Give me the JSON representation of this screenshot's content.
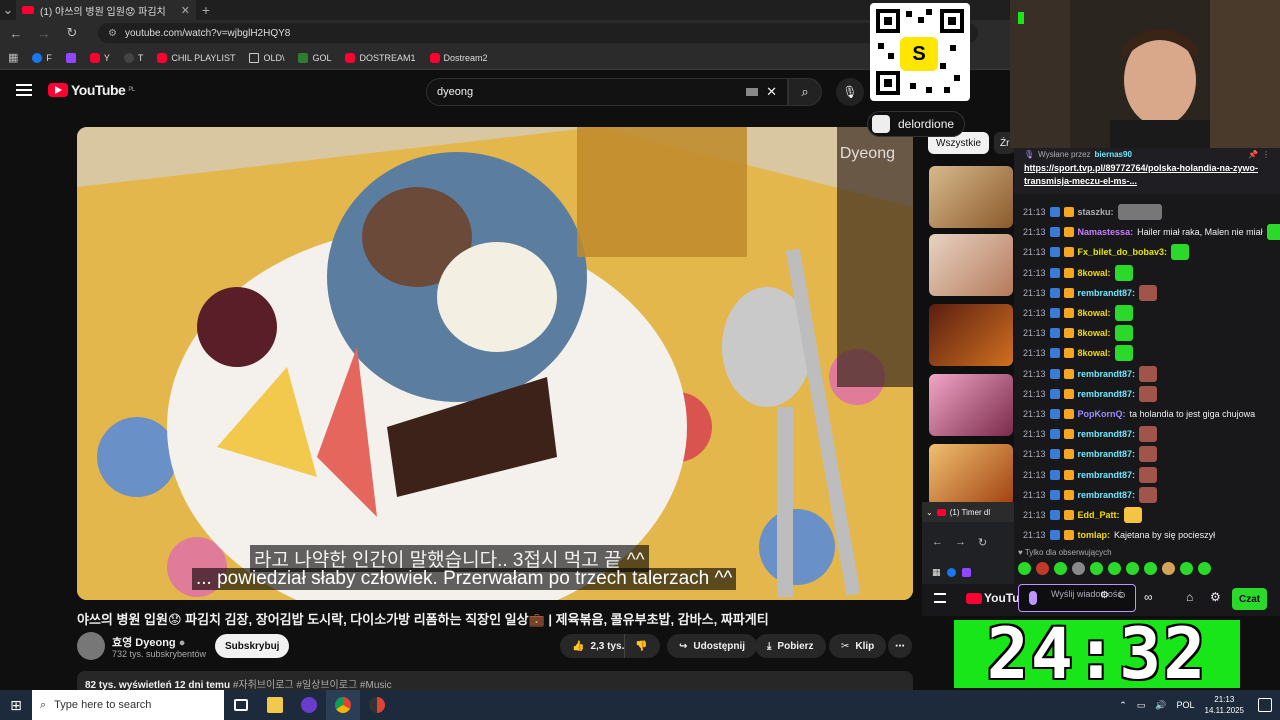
{
  "browser": {
    "tab_title": "(1) 야쓰의 병원 입원😟 파김치",
    "address": "youtube.com/watch?v=wjbglH2HQY8",
    "bookmarks": [
      "F",
      "Y",
      "T",
      "CHIL PLAYLIST",
      "OLD\\",
      "GOL",
      "DOSTREAM1",
      "Dostream2"
    ]
  },
  "youtube": {
    "region": "PL",
    "logo_text": "YouTube",
    "search_query": "dyeong",
    "video": {
      "subtitle_korean": "라고 나약한 인간이 말했습니다.. 3접시 먹고 끝 ^^",
      "subtitle_polish": "... powiedział słaby człowiek.  Przerwałam po trzech talerzach ^^",
      "watermark": "Dyeong",
      "title": "야쓰의 병원 입원😟 파김치 김장, 장어김밥 도시락, 다이소가방 리폼하는 직장인 일상💼 | 제육볶음, 콜유부초밥, 감바스, 짜파게티",
      "channel_name": "효영 Dyeong",
      "channel_subs": "732 tys. subskrybentów",
      "subscribe_label": "Subskrybuj",
      "likes": "2,3 tys.",
      "share_label": "Udostępnij",
      "download_label": "Pobierz",
      "clip_label": "Klip",
      "views_date": "82 tys. wyświetleń  12 dni temu",
      "hashtags": "#자취브이로그 #일상브이로그 #Music"
    },
    "sidebar": {
      "chip_all": "Wszystkie",
      "chip_2": "Źr"
    }
  },
  "overlay": {
    "qr_letter": "S",
    "handle": "delordione"
  },
  "chat": {
    "pinned_by": "Wysłane przez",
    "pinned_user": "biernas90",
    "pinned_link": "https://sport.tvp.pl/89772764/polska-holandia-na-zywo-transmisja-meczu-el-ms-...",
    "messages": [
      {
        "ts": "21:13",
        "user": "staszku:",
        "text": "",
        "color": "#b0b0b0"
      },
      {
        "ts": "21:13",
        "user": "Namastessa:",
        "text": "Hailer miał raka, Malen nie miał",
        "color": "#c77dff"
      },
      {
        "ts": "21:13",
        "user": "Fx_bilet_do_bobav3:",
        "text": "",
        "color": "#e6e600"
      },
      {
        "ts": "21:13",
        "user": "8kowal:",
        "text": "",
        "color": "#f5d90a"
      },
      {
        "ts": "21:13",
        "user": "rembrandt87:",
        "text": "",
        "color": "#6ee7ff"
      },
      {
        "ts": "21:13",
        "user": "8kowal:",
        "text": "",
        "color": "#f5d90a"
      },
      {
        "ts": "21:13",
        "user": "8kowal:",
        "text": "",
        "color": "#f5d90a"
      },
      {
        "ts": "21:13",
        "user": "8kowal:",
        "text": "",
        "color": "#f5d90a"
      },
      {
        "ts": "21:13",
        "user": "rembrandt87:",
        "text": "",
        "color": "#6ee7ff"
      },
      {
        "ts": "21:13",
        "user": "rembrandt87:",
        "text": "",
        "color": "#6ee7ff"
      },
      {
        "ts": "21:13",
        "user": "PopKornQ:",
        "text": "ta holandia to jest giga chujowa",
        "color": "#9b8cff"
      },
      {
        "ts": "21:13",
        "user": "rembrandt87:",
        "text": "",
        "color": "#6ee7ff"
      },
      {
        "ts": "21:13",
        "user": "rembrandt87:",
        "text": "",
        "color": "#6ee7ff"
      },
      {
        "ts": "21:13",
        "user": "rembrandt87:",
        "text": "",
        "color": "#6ee7ff"
      },
      {
        "ts": "21:13",
        "user": "rembrandt87:",
        "text": "",
        "color": "#6ee7ff"
      },
      {
        "ts": "21:13",
        "user": "Edd_Patt:",
        "text": "",
        "color": "#f5d90a"
      },
      {
        "ts": "21:13",
        "user": "tomlap:",
        "text": "Kajetana by się pocieszył",
        "color": "#f5d90a"
      }
    ],
    "followers_only": "Tylko dla obserwujących",
    "input_placeholder": "Wyślij wiadomość",
    "chat_button": "Czat"
  },
  "mini_browser": {
    "tab_label": "(1) Timer dl"
  },
  "timer": "24:32",
  "taskbar": {
    "search_placeholder": "Type here to search",
    "lang": "POL",
    "time": "21:13",
    "date": "14.11.2025"
  }
}
